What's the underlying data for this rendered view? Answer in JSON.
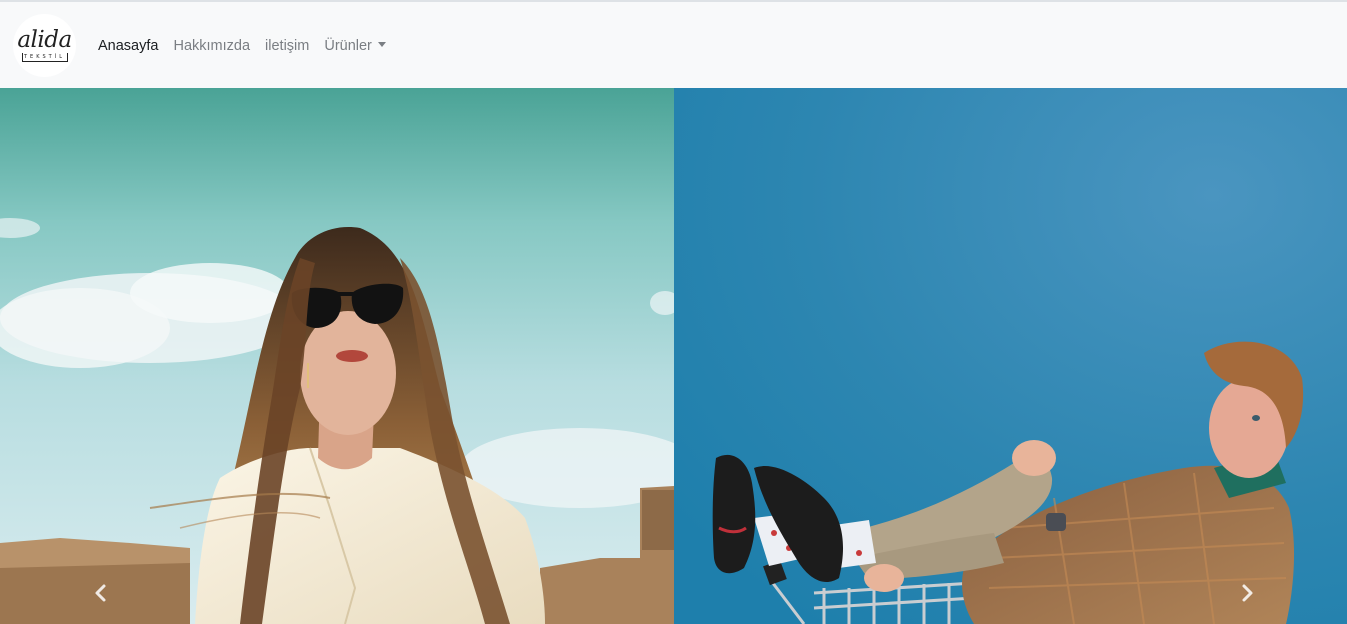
{
  "brand": {
    "name": "alida",
    "tagline": "TEKSTİL",
    "logo_icon": "alida-logo"
  },
  "nav": {
    "items": [
      {
        "label": "Anasayfa",
        "active": true
      },
      {
        "label": "Hakkımızda",
        "active": false
      },
      {
        "label": "iletişim",
        "active": false
      },
      {
        "label": "Ürünler",
        "active": false,
        "dropdown": true
      }
    ]
  },
  "carousel": {
    "prev_icon": "chevron-left-icon",
    "next_icon": "chevron-right-icon",
    "slides": [
      {
        "description": "photo-woman-sunglasses"
      },
      {
        "description": "photo-man-shopping-cart"
      }
    ]
  },
  "colors": {
    "navbar_bg": "#f8f9fa",
    "active_link": "#1b1e21",
    "link": "#7a7e83",
    "slide_right_bg": "#2f86b3"
  }
}
